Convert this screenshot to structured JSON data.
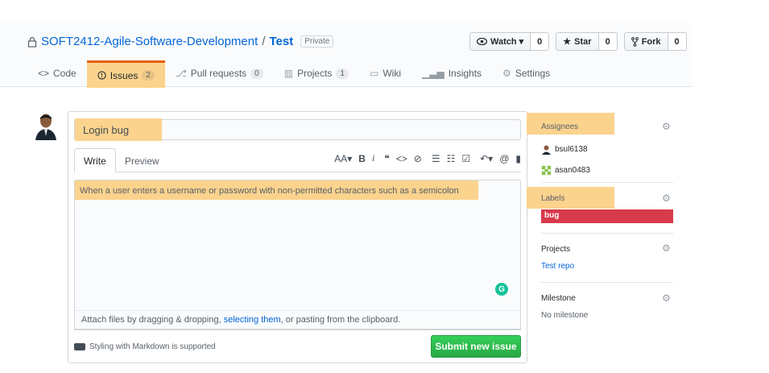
{
  "repo": {
    "owner": "SOFT2412-Agile-Software-Development",
    "separator": "/",
    "name": "Test",
    "visibility": "Private"
  },
  "actions": [
    {
      "label": "Watch ▾",
      "count": "0",
      "icon": "eye-icon"
    },
    {
      "label": "Star",
      "count": "0",
      "icon": "star-icon"
    },
    {
      "label": "Fork",
      "count": "0",
      "icon": "fork-icon"
    }
  ],
  "tabs": [
    {
      "label": "Code",
      "icon": "code-icon"
    },
    {
      "label": "Issues",
      "count": "2",
      "icon": "issue-icon",
      "selected": true
    },
    {
      "label": "Pull requests",
      "count": "0",
      "icon": "pull-request-icon"
    },
    {
      "label": "Projects",
      "count": "1",
      "icon": "project-icon"
    },
    {
      "label": "Wiki",
      "icon": "book-icon"
    },
    {
      "label": "Insights",
      "icon": "graph-icon"
    },
    {
      "label": "Settings",
      "icon": "gear-icon"
    }
  ],
  "issue_form": {
    "title_value": "Login bug",
    "write_tab": "Write",
    "preview_tab": "Preview",
    "toolbar": {
      "header": "AA▾",
      "bold": "B",
      "italic": "i",
      "quote": "❝",
      "code": "<>",
      "link": "⊘",
      "ul": "☰",
      "ol": "☷",
      "tasks": "☑",
      "reply": "↶▾",
      "mention": "@",
      "bookmark": "▮"
    },
    "body_text": "When a user enters a username or password with non-permitted characters such as a semicolon",
    "attach_before": "Attach files by dragging & dropping, ",
    "attach_link": "selecting them",
    "attach_after": ", or pasting from the clipboard.",
    "markdown_note": "Styling with Markdown is supported",
    "submit_label": "Submit new issue",
    "grammarly": "G"
  },
  "sidebar": {
    "assignees_label": "Assignees",
    "assignees": [
      "bsul6138",
      "asan0483"
    ],
    "labels_label": "Labels",
    "label_name": "bug",
    "projects_label": "Projects",
    "project_name": "Test repo",
    "milestone_label": "Milestone",
    "milestone_value": "No milestone"
  },
  "colors": {
    "highlight": "#fbd38d",
    "accent_tab": "#e36209",
    "link": "#0366d6",
    "submit_green": "#28a745",
    "bug_red": "#d73a4a"
  }
}
